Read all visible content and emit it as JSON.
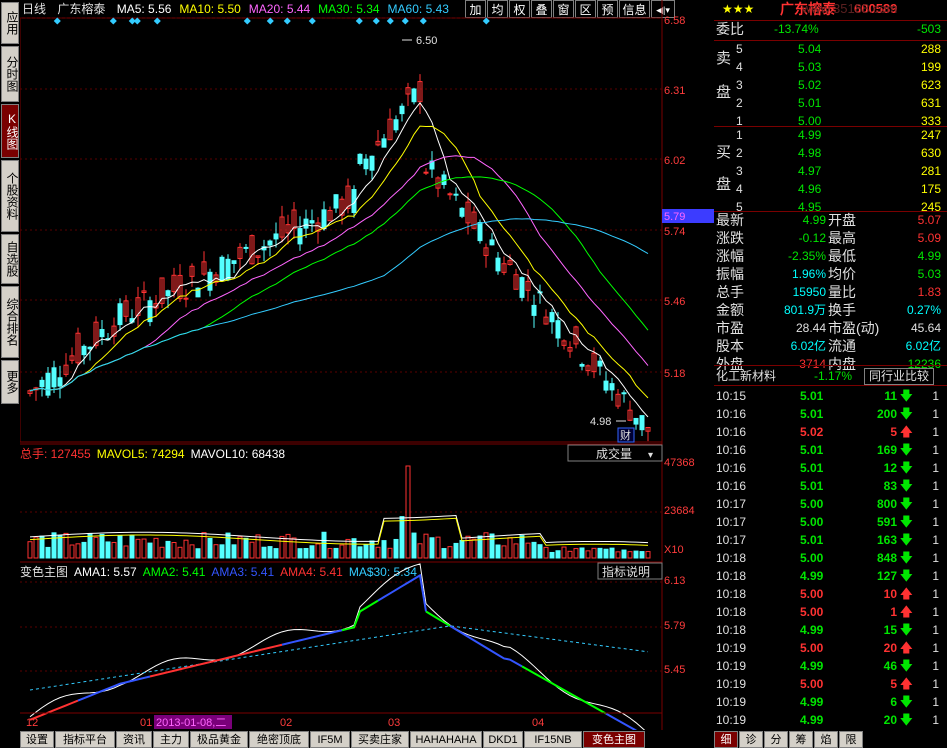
{
  "left_tabs": [
    "应用",
    "分时图",
    "K线图",
    "个股资料",
    "自选股",
    "综合排名",
    "更多"
  ],
  "chart_header": {
    "period": "日线",
    "stock": "广东榕泰",
    "ma": [
      {
        "label": "MA5:",
        "value": "5.56",
        "color": "#ffffff"
      },
      {
        "label": "MA10:",
        "value": "5.50",
        "color": "#ffff00"
      },
      {
        "label": "MA20:",
        "value": "5.44",
        "color": "#ff66ff"
      },
      {
        "label": "MA30:",
        "value": "5.34",
        "color": "#00ff00"
      },
      {
        "label": "MA60:",
        "value": "5.43",
        "color": "#33ccff"
      }
    ],
    "buttons": [
      "加",
      "均",
      "权",
      "叠",
      "窗",
      "区",
      "预",
      "信息"
    ],
    "nav_icon": "arrow-left-right-icon"
  },
  "price_axis": [
    "6.58",
    "6.31",
    "6.02",
    "5.74",
    "5.46",
    "5.18"
  ],
  "current_price_tag": "5.79",
  "annotations": {
    "high": "6.50",
    "low": "4.98",
    "cai": "财"
  },
  "volume": {
    "title": "总手:",
    "total": "127455",
    "mavol5_label": "MAVOL5:",
    "mavol5": "74294",
    "mavol10_label": "MAVOL10:",
    "mavol10": "68438",
    "selector": "成交量",
    "axis": [
      "47368",
      "23684",
      "X10"
    ]
  },
  "indicator": {
    "title": "变色主图",
    "ama1_label": "AMA1:",
    "ama1": "5.57",
    "ama2_label": "AMA2:",
    "ama2": "5.41",
    "ama3_label": "AMA3:",
    "ama3": "5.41",
    "ama4_label": "AMA4:",
    "ama4": "5.41",
    "mas30_label": "MA$30:",
    "mas30": "5.34",
    "button": "指标说明",
    "axis": [
      "6.13",
      "5.79",
      "5.45"
    ]
  },
  "date_axis": [
    "12",
    "01",
    "2013-01-08,二",
    "02",
    "03",
    "04"
  ],
  "bottom_tabs": [
    "设置",
    "指标平台",
    "资讯",
    "主力",
    "极品黄金",
    "绝密顶底",
    "IF5M",
    "买卖庄家",
    "HAHAHAHA",
    "DKD1",
    "IF15NB",
    "变色主图"
  ],
  "right_panel": {
    "stars": "★★★",
    "name": "广东榕泰",
    "code": "600589",
    "watermark": "www.35188.com",
    "weibi_label": "委比",
    "weibi": "-13.74%",
    "weicha": "-503",
    "sell_label": [
      "卖",
      "盘"
    ],
    "buy_label": [
      "买",
      "盘"
    ],
    "sell": [
      {
        "n": "5",
        "p": "5.04",
        "v": "288"
      },
      {
        "n": "4",
        "p": "5.03",
        "v": "199"
      },
      {
        "n": "3",
        "p": "5.02",
        "v": "623"
      },
      {
        "n": "2",
        "p": "5.01",
        "v": "631"
      },
      {
        "n": "1",
        "p": "5.00",
        "v": "333"
      }
    ],
    "buy": [
      {
        "n": "1",
        "p": "4.99",
        "v": "247"
      },
      {
        "n": "2",
        "p": "4.98",
        "v": "630"
      },
      {
        "n": "3",
        "p": "4.97",
        "v": "281"
      },
      {
        "n": "4",
        "p": "4.96",
        "v": "175"
      },
      {
        "n": "5",
        "p": "4.95",
        "v": "245"
      }
    ],
    "stats": [
      {
        "l1": "最新",
        "v1": "4.99",
        "c1": "grn",
        "l2": "开盘",
        "v2": "5.07",
        "c2": "red"
      },
      {
        "l1": "涨跌",
        "v1": "-0.12",
        "c1": "grn",
        "l2": "最高",
        "v2": "5.09",
        "c2": "red"
      },
      {
        "l1": "涨幅",
        "v1": "-2.35%",
        "c1": "grn",
        "l2": "最低",
        "v2": "4.99",
        "c2": "grn"
      },
      {
        "l1": "振幅",
        "v1": "1.96%",
        "c1": "cy",
        "l2": "均价",
        "v2": "5.03",
        "c2": "grn"
      },
      {
        "l1": "总手",
        "v1": "15950",
        "c1": "cy",
        "l2": "量比",
        "v2": "1.83",
        "c2": "red"
      },
      {
        "l1": "金额",
        "v1": "801.9万",
        "c1": "cy",
        "l2": "换手",
        "v2": "0.27%",
        "c2": "cy"
      },
      {
        "l1": "市盈",
        "v1": "28.44",
        "c1": "wh",
        "l2": "市盈(动)",
        "v2": "45.64",
        "c2": "wh"
      },
      {
        "l1": "股本",
        "v1": "6.02亿",
        "c1": "cy",
        "l2": "流通",
        "v2": "6.02亿",
        "c2": "cy"
      },
      {
        "l1": "外盘",
        "v1": "3714",
        "c1": "red",
        "l2": "内盘",
        "v2": "12236",
        "c2": "grn"
      }
    ],
    "sector": {
      "name": "化工新材料",
      "change": "-1.17%",
      "button": "同行业比较"
    },
    "ticks": [
      {
        "t": "10:15",
        "p": "5.01",
        "v": "11",
        "d": "down",
        "x": "1"
      },
      {
        "t": "10:16",
        "p": "5.01",
        "v": "200",
        "d": "down",
        "x": "1"
      },
      {
        "t": "10:16",
        "p": "5.02",
        "v": "5",
        "d": "up",
        "x": "1"
      },
      {
        "t": "10:16",
        "p": "5.01",
        "v": "169",
        "d": "down",
        "x": "1"
      },
      {
        "t": "10:16",
        "p": "5.01",
        "v": "12",
        "d": "down",
        "x": "1"
      },
      {
        "t": "10:16",
        "p": "5.01",
        "v": "83",
        "d": "down",
        "x": "1"
      },
      {
        "t": "10:17",
        "p": "5.00",
        "v": "800",
        "d": "down",
        "x": "1"
      },
      {
        "t": "10:17",
        "p": "5.00",
        "v": "591",
        "d": "down",
        "x": "1"
      },
      {
        "t": "10:17",
        "p": "5.01",
        "v": "163",
        "d": "down",
        "x": "1"
      },
      {
        "t": "10:18",
        "p": "5.00",
        "v": "848",
        "d": "down",
        "x": "1"
      },
      {
        "t": "10:18",
        "p": "4.99",
        "v": "127",
        "d": "down",
        "x": "1"
      },
      {
        "t": "10:18",
        "p": "5.00",
        "v": "10",
        "d": "up",
        "x": "1"
      },
      {
        "t": "10:18",
        "p": "5.00",
        "v": "1",
        "d": "up",
        "x": "1"
      },
      {
        "t": "10:18",
        "p": "4.99",
        "v": "15",
        "d": "down",
        "x": "1"
      },
      {
        "t": "10:19",
        "p": "5.00",
        "v": "20",
        "d": "up",
        "x": "1"
      },
      {
        "t": "10:19",
        "p": "4.99",
        "v": "46",
        "d": "down",
        "x": "1"
      },
      {
        "t": "10:19",
        "p": "5.00",
        "v": "5",
        "d": "up",
        "x": "1"
      },
      {
        "t": "10:19",
        "p": "4.99",
        "v": "6",
        "d": "down",
        "x": "1"
      },
      {
        "t": "10:19",
        "p": "4.99",
        "v": "20",
        "d": "down",
        "x": "1"
      }
    ],
    "bottom_tabs": [
      "细",
      "诊",
      "分",
      "筹",
      "焰",
      "限"
    ]
  }
}
